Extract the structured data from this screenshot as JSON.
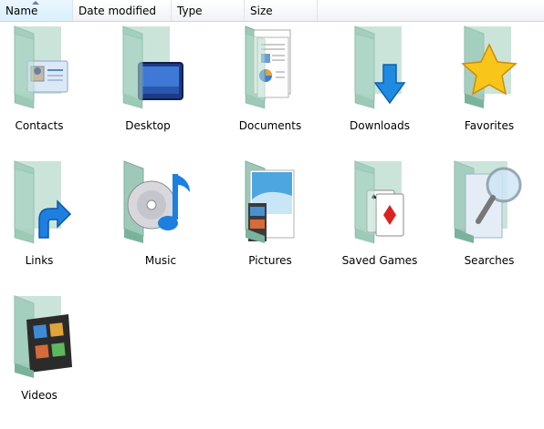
{
  "header": {
    "columns": [
      {
        "label": "Name",
        "sorted": true
      },
      {
        "label": "Date modified"
      },
      {
        "label": "Type"
      },
      {
        "label": "Size"
      }
    ]
  },
  "items": [
    {
      "label": "Contacts",
      "icon": "contacts-card-icon"
    },
    {
      "label": "Desktop",
      "icon": "monitor-icon"
    },
    {
      "label": "Documents",
      "icon": "document-pages-icon"
    },
    {
      "label": "Downloads",
      "icon": "down-arrow-icon"
    },
    {
      "label": "Favorites",
      "icon": "star-icon"
    },
    {
      "label": "Links",
      "icon": "shortcut-arrow-icon"
    },
    {
      "label": "Music",
      "icon": "cd-music-note-icon"
    },
    {
      "label": "Pictures",
      "icon": "photo-icon"
    },
    {
      "label": "Saved Games",
      "icon": "playing-card-icon"
    },
    {
      "label": "Searches",
      "icon": "magnifier-icon"
    },
    {
      "label": "Videos",
      "icon": "film-strip-icon"
    }
  ],
  "colors": {
    "folder_front": "#b9ddcd",
    "folder_back": "#9ec9b8",
    "header_border": "#d5d5d5"
  }
}
